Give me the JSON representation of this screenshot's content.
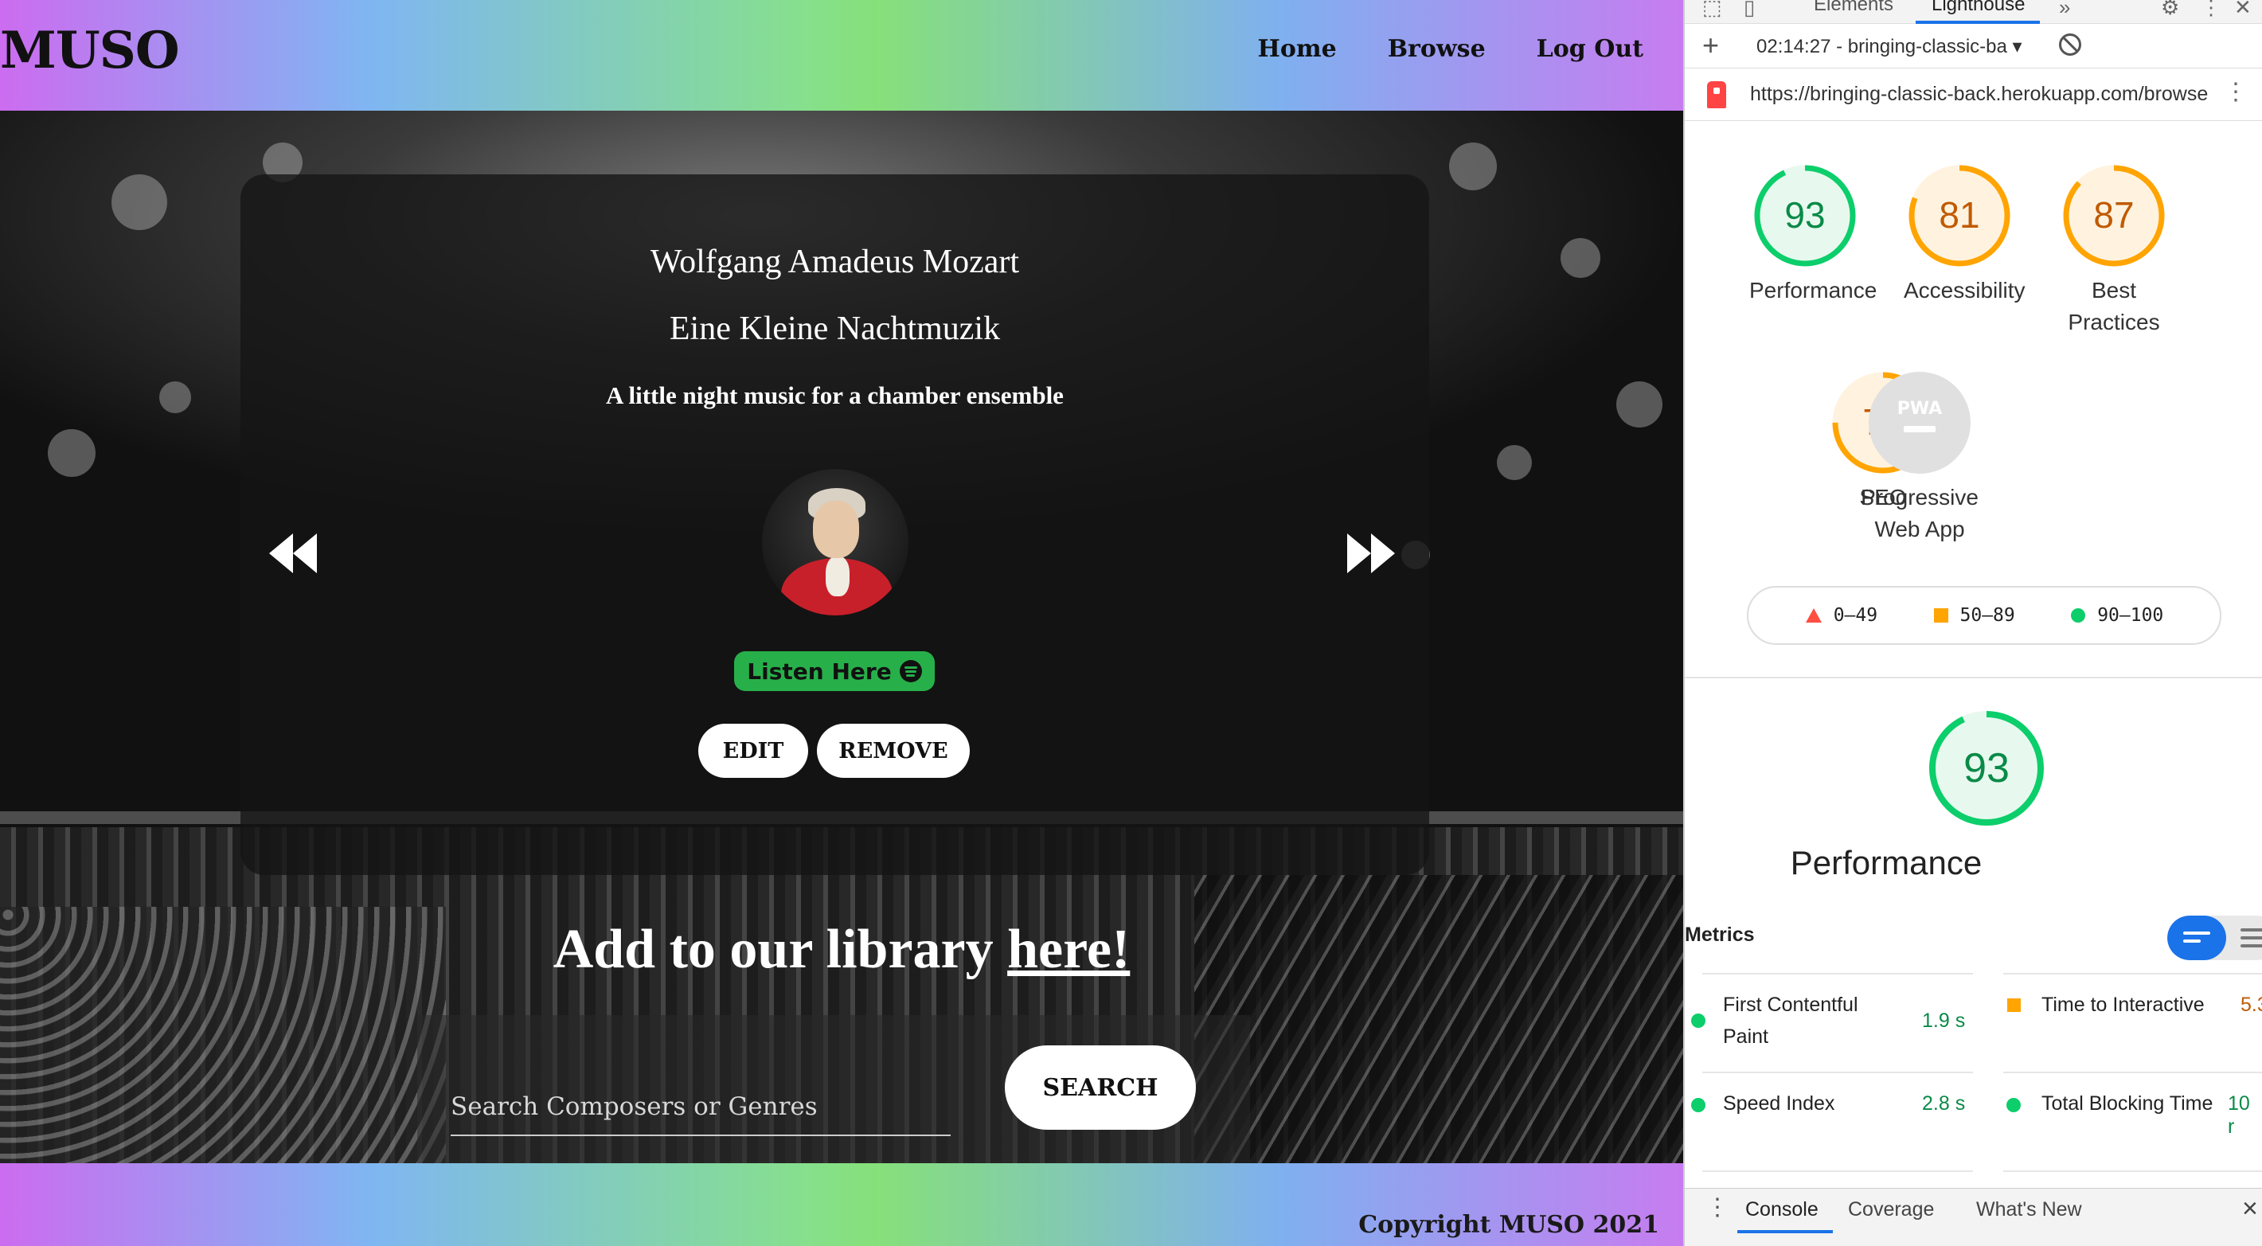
{
  "site": {
    "logo": "MUSO",
    "nav": [
      "Home",
      "Browse",
      "Log Out"
    ],
    "card": {
      "composer": "Wolfgang Amadeus Mozart",
      "piece": "Eine Kleine Nachtmuzik",
      "description": "A little night music for a chamber ensemble",
      "listen_label": "Listen Here",
      "edit_label": "EDIT",
      "remove_label": "REMOVE"
    },
    "add_heading_prefix": "Add to our library ",
    "add_heading_link": "here!",
    "search": {
      "placeholder": "Search Composers or Genres",
      "button_label": "SEARCH"
    },
    "footer": "Copyright MUSO 2021",
    "colors": {
      "listen_green": "#27b04a",
      "card_bg": "#141414"
    }
  },
  "devtools": {
    "tabs": [
      "Elements",
      "Lighthouse"
    ],
    "active_tab": "Lighthouse",
    "report_select": "02:14:27 - bringing-classic-ba",
    "url": "https://bringing-classic-back.herokuapp.com/browse",
    "scores": [
      {
        "value": "93",
        "label_lines": [
          "Performance"
        ],
        "color": "#0cce6b"
      },
      {
        "value": "81",
        "label_lines": [
          "Accessibility"
        ],
        "color": "#ffa400"
      },
      {
        "value": "87",
        "label_lines": [
          "Best",
          "Practices"
        ],
        "color": "#ffa400"
      },
      {
        "value": "75",
        "label_lines": [
          "SEO"
        ],
        "color": "#ffa400"
      }
    ],
    "pwa": {
      "icon_text": "PWA",
      "label_lines": [
        "Progressive",
        "Web App"
      ]
    },
    "legend": [
      {
        "range": "0–49",
        "color": "#ff4e42",
        "shape": "triangle"
      },
      {
        "range": "50–89",
        "color": "#ffa400",
        "shape": "square"
      },
      {
        "range": "90–100",
        "color": "#0cce6b",
        "shape": "circle"
      }
    ],
    "performance": {
      "score": "93",
      "title": "Performance"
    },
    "metrics_label": "Metrics",
    "metrics": [
      {
        "name_lines": [
          "First Contentful",
          "Paint"
        ],
        "value": "1.9 s",
        "status": "pass"
      },
      {
        "name_lines": [
          "Time to Interactive"
        ],
        "value": "5.3",
        "status": "average"
      },
      {
        "name_lines": [
          "Speed Index"
        ],
        "value": "2.8 s",
        "status": "pass"
      },
      {
        "name_lines": [
          "Total Blocking Time"
        ],
        "value": "10 r",
        "status": "pass"
      }
    ],
    "drawer_tabs": [
      "Console",
      "Coverage",
      "What's New"
    ]
  }
}
